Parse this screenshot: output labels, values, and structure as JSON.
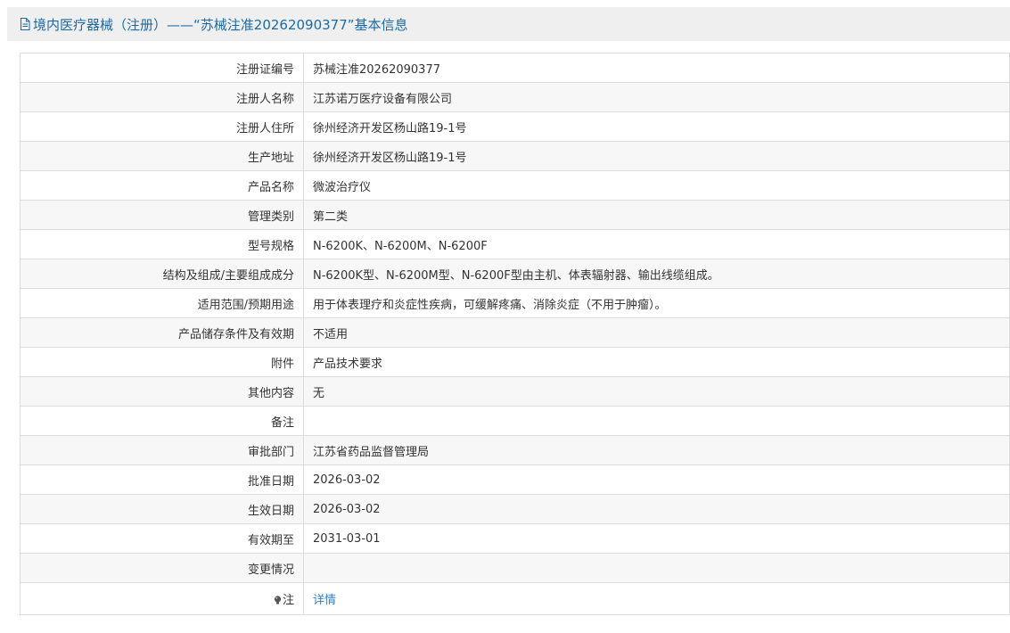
{
  "header": {
    "title": "境内医疗器械（注册）——“苏械注准20262090377”基本信息",
    "icon": "document-icon"
  },
  "rows": [
    {
      "label": "注册证编号",
      "value": "苏械注准20262090377"
    },
    {
      "label": "注册人名称",
      "value": "江苏诺万医疗设备有限公司"
    },
    {
      "label": "注册人住所",
      "value": "徐州经济开发区杨山路19-1号"
    },
    {
      "label": "生产地址",
      "value": "徐州经济开发区杨山路19-1号"
    },
    {
      "label": "产品名称",
      "value": "微波治疗仪"
    },
    {
      "label": "管理类别",
      "value": "第二类"
    },
    {
      "label": "型号规格",
      "value": "N-6200K、N-6200M、N-6200F"
    },
    {
      "label": "结构及组成/主要组成成分",
      "value": "N-6200K型、N-6200M型、N-6200F型由主机、体表辐射器、输出线缆组成。"
    },
    {
      "label": "适用范围/预期用途",
      "value": "用于体表理疗和炎症性疾病，可缓解疼痛、消除炎症（不用于肿瘤）。"
    },
    {
      "label": "产品储存条件及有效期",
      "value": "不适用"
    },
    {
      "label": "附件",
      "value": "产品技术要求"
    },
    {
      "label": "其他内容",
      "value": "无"
    },
    {
      "label": "备注",
      "value": ""
    },
    {
      "label": "审批部门",
      "value": "江苏省药品监督管理局"
    },
    {
      "label": "批准日期",
      "value": "2026-03-02"
    },
    {
      "label": "生效日期",
      "value": "2026-03-02"
    },
    {
      "label": "有效期至",
      "value": "2031-03-01"
    },
    {
      "label": "变更情况",
      "value": ""
    }
  ],
  "note_row": {
    "label": "注",
    "icon": "bulb-icon",
    "link_text": "详情"
  },
  "colors": {
    "header_text": "#1a6aa8",
    "link": "#2f80c5",
    "header_bg": "#efefef",
    "border": "#dcdcdc"
  }
}
